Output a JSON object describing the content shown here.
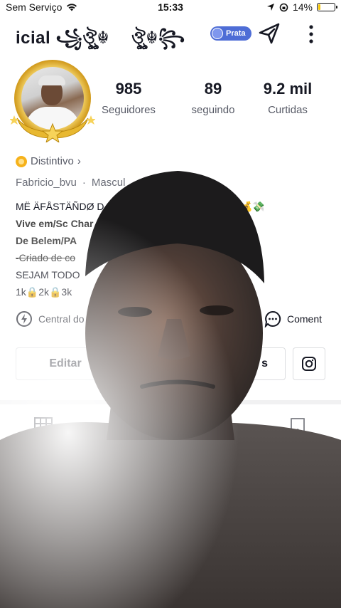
{
  "status_bar": {
    "carrier": "Sem Serviço",
    "time": "15:33",
    "battery": "14%",
    "battery_level": 0.14
  },
  "header": {
    "name": "icial ꧁ঔৣ☬",
    "name_decoration": "ঔৣ☬꧂ ",
    "level_badge": "Prata"
  },
  "stats": {
    "followers": {
      "value": "985",
      "label": "Seguidores"
    },
    "following": {
      "value": "89",
      "label": "seguindo"
    },
    "likes": {
      "value": "9.2 mil",
      "label": "Curtidas"
    }
  },
  "distintivo": {
    "label": "Distintivo",
    "chevron": "›"
  },
  "meta": {
    "username": "Fabricio_bvu",
    "separator": "·",
    "gender": "Mascul"
  },
  "bio": {
    "line1": "MË ÄFÅSTÄÑDØ D",
    "line1_emoji": "💰💸",
    "line2": "Vive em/Sc Char",
    "line3": "De Belem/PA",
    "line4": "-Criado de co",
    "line5": "SEJAM TODO",
    "line6": "1k🔒2k🔒3k"
  },
  "actions": {
    "central_label": "Central do",
    "comments_label": "Coment"
  },
  "buttons": {
    "edit": "Editar",
    "second_suffix": "s"
  },
  "icons": {
    "share": "share-arrow-icon",
    "more": "more-vertical-icon",
    "instagram": "instagram-icon",
    "grid": "grid-icon",
    "saved": "bookmark-icon",
    "collapse": "chevron-up-icon"
  },
  "colors": {
    "badge": "#4e6dd6",
    "text_primary": "#161823",
    "text_secondary": "#575a66",
    "gold": "#f4d46a"
  }
}
